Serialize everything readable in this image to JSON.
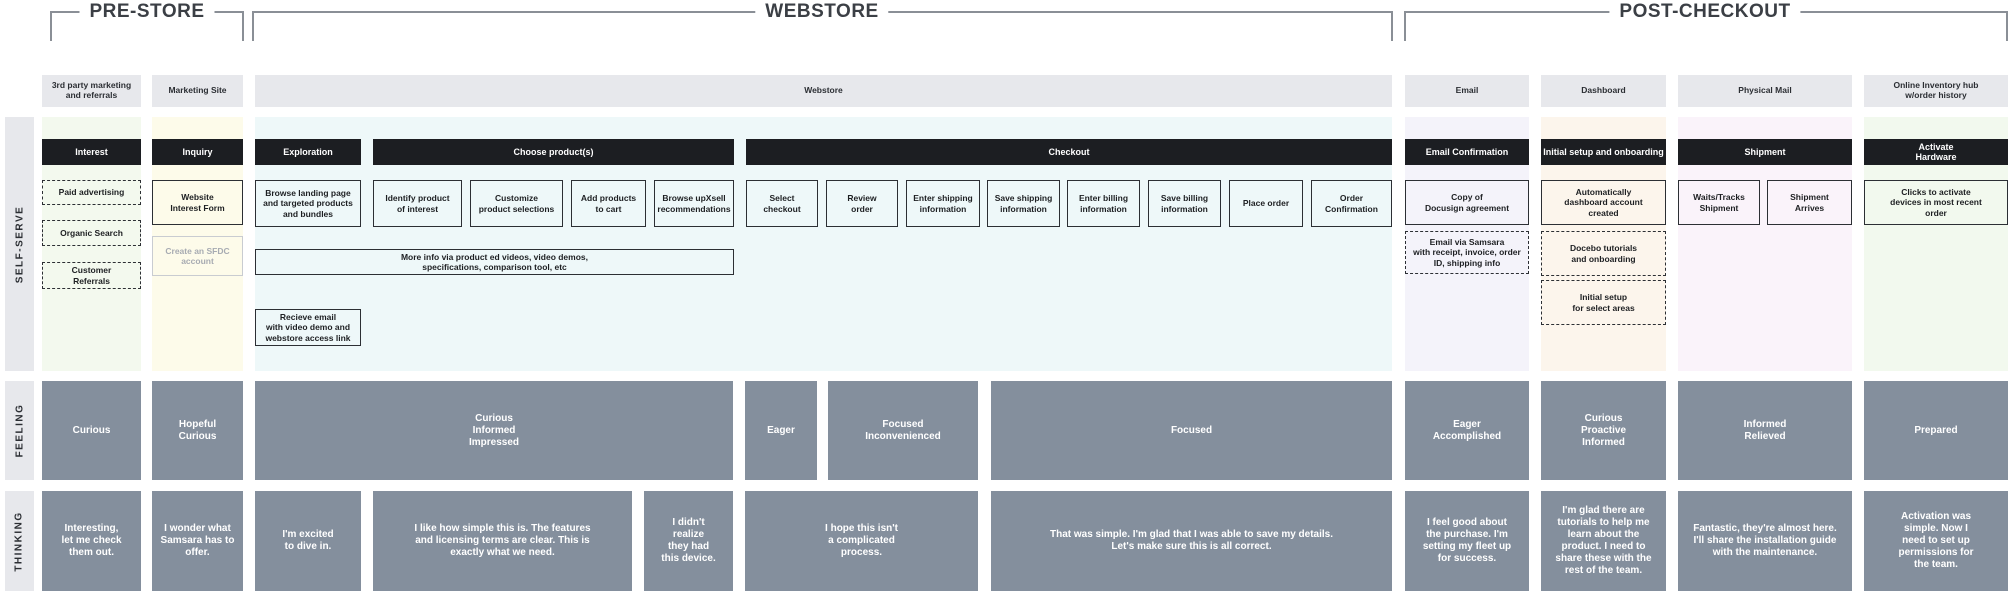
{
  "phases": {
    "prestore": "PRE-STORE",
    "webstore": "WEBSTORE",
    "postcheckout": "POST-CHECKOUT"
  },
  "lanes": {
    "selfserve": "SELF-SERVE",
    "feeling": "FEELING",
    "thinking": "THINKING"
  },
  "channels": {
    "c1": "3rd party marketing\nand referrals",
    "c2": "Marketing Site",
    "c3": "Webstore",
    "c4": "Email",
    "c5": "Dashboard",
    "c6": "Physical Mail",
    "c7": "Online Inventory hub\nw/order history"
  },
  "stages": {
    "interest": "Interest",
    "inquiry": "Inquiry",
    "exploration": "Exploration",
    "choose": "Choose product(s)",
    "checkout": "Checkout",
    "emailconf": "Email Confirmation",
    "setup": "Initial setup and onboarding",
    "shipment": "Shipment",
    "activate": "Activate\nHardware"
  },
  "cards": {
    "paid": "Paid advertising",
    "organic": "Organic Search",
    "referrals": "Customer\nReferrals",
    "interestform": "Website\nInterest Form",
    "sfdc": "Create an SFDC\naccount",
    "browse": "Browse landing page\nand targeted products\nand bundles",
    "identify": "Identify product\nof interest",
    "customize": "Customize\nproduct selections",
    "addcart": "Add products\nto cart",
    "upxsell": "Browse upXsell\nrecommendations",
    "moreinfo": "More info via product ed videos, video demos,\nspecifications, comparison tool, etc",
    "recieve": "Recieve email\nwith video demo and\nwebstore access link",
    "selectco": "Select\ncheckout",
    "review": "Review\norder",
    "entership": "Enter shipping\ninformation",
    "saveship": "Save shipping\ninformation",
    "enterbill": "Enter billing\ninformation",
    "savebill": "Save billing\ninformation",
    "place": "Place order",
    "confirm": "Order\nConfirmation",
    "docusign": "Copy of\nDocusign agreement",
    "samsaraemail": "Email via Samsara\nwith receipt, invoice, order\nID, shipping info",
    "autodash": "Automatically\ndashboard account\ncreated",
    "docebo": "Docebo tutorials\nand onboarding",
    "initsetup": "Initial setup\nfor select areas",
    "waits": "Waits/Tracks\nShipment",
    "arrives": "Shipment\nArrives",
    "clicks": "Clicks to activate\ndevices in most recent\norder"
  },
  "feelings": {
    "f1": "Curious",
    "f2": "Hopeful\nCurious",
    "f3": "Curious\nInformed\nImpressed",
    "f4": "Eager",
    "f5": "Focused\nInconvenienced",
    "f6": "Focused",
    "f7": "Eager\nAccomplished",
    "f8": "Curious\nProactive\nInformed",
    "f9": "Informed\nRelieved",
    "f10": "Prepared"
  },
  "thoughts": {
    "t1": "Interesting,\nlet me check\nthem out.",
    "t2": "I wonder what\nSamsara has to\noffer.",
    "t3": "I'm excited\nto dive in.",
    "t4": "I like how simple this is. The features\nand licensing terms are clear. This is\nexactly what we need.",
    "t5": "I didn't\nrealize\nthey had\nthis device.",
    "t6": "I hope this isn't\na complicated\nprocess.",
    "t7": "That was simple. I'm glad that I was able to save my details.\nLet's make sure this is all correct.",
    "t8": "I feel good about\nthe purchase. I'm\nsetting my fleet up\nfor success.",
    "t9": "I'm glad there are\ntutorials to help me\nlearn about the\nproduct. I need to\nshare these with the\nrest of the team.",
    "t10": "Fantastic, they're almost here.\nI'll share the installation guide\nwith the maintenance.",
    "t11": "Activation was\nsimple. Now I\nneed to set up\npermissions for\nthe team."
  },
  "colors": {
    "stage_bg": "#1c1e22",
    "block_bg": "#848f9d",
    "channel_bg": "#e7e8ec"
  }
}
